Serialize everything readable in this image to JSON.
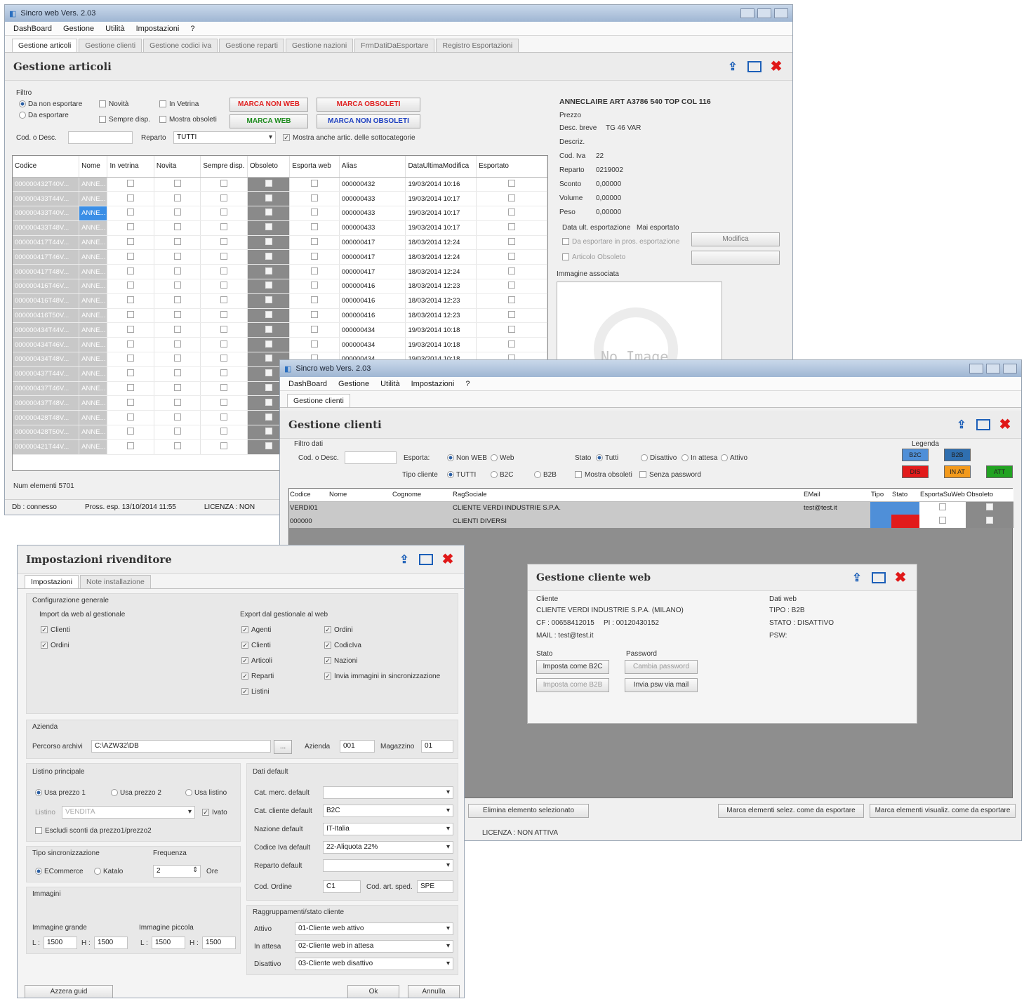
{
  "app": {
    "title": "Sincro web Vers. 2.03",
    "menu": [
      "DashBoard",
      "Gestione",
      "Utilità",
      "Impostazioni",
      "?"
    ]
  },
  "articoli": {
    "tabs": [
      "Gestione articoli",
      "Gestione clienti",
      "Gestione codici iva",
      "Gestione reparti",
      "Gestione nazioni",
      "FrmDatiDaEsportare",
      "Registro Esportazioni"
    ],
    "title": "Gestione articoli",
    "filter_label": "Filtro",
    "radio_non_esportare": "Da non esportare",
    "radio_esportare": "Da esportare",
    "chk_novita": "Novità",
    "chk_in_vetrina": "In Vetrina",
    "chk_sempre_disp": "Sempre disp.",
    "chk_mostra_obsoleti": "Mostra obsoleti",
    "btn_marca_non_web": "MARCA NON WEB",
    "btn_marca_obsoleti": "MARCA OBSOLETI",
    "btn_marca_web": "MARCA WEB",
    "btn_marca_non_obsoleti": "MARCA NON OBSOLETI",
    "cod_desc_label": "Cod. o Desc.",
    "reparto_label": "Reparto",
    "reparto_value": "TUTTI",
    "mostra_sottocat": "Mostra anche artic. delle sottocategorie",
    "columns": [
      "Codice",
      "Nome",
      "In vetrina",
      "Novita",
      "Sempre disp.",
      "Obsoleto",
      "Esporta web",
      "Alias",
      "DataUltimaModifica",
      "Esportato"
    ],
    "rows": [
      {
        "codice": "000000432T40V...",
        "nome": "ANNE...",
        "alias": "000000432",
        "data": "19/03/2014 10:16"
      },
      {
        "codice": "000000433T44V...",
        "nome": "ANNE...",
        "alias": "000000433",
        "data": "19/03/2014 10:17"
      },
      {
        "codice": "000000433T40V...",
        "nome": "ANNE...",
        "alias": "000000433",
        "data": "19/03/2014 10:17"
      },
      {
        "codice": "000000433T48V...",
        "nome": "ANNE...",
        "alias": "000000433",
        "data": "19/03/2014 10:17"
      },
      {
        "codice": "000000417T44V...",
        "nome": "ANNE...",
        "alias": "000000417",
        "data": "18/03/2014 12:24"
      },
      {
        "codice": "000000417T46V...",
        "nome": "ANNE...",
        "alias": "000000417",
        "data": "18/03/2014 12:24"
      },
      {
        "codice": "000000417T48V...",
        "nome": "ANNE...",
        "alias": "000000417",
        "data": "18/03/2014 12:24"
      },
      {
        "codice": "000000416T46V...",
        "nome": "ANNE...",
        "alias": "000000416",
        "data": "18/03/2014 12:23"
      },
      {
        "codice": "000000416T48V...",
        "nome": "ANNE...",
        "alias": "000000416",
        "data": "18/03/2014 12:23"
      },
      {
        "codice": "000000416T50V...",
        "nome": "ANNE...",
        "alias": "000000416",
        "data": "18/03/2014 12:23"
      },
      {
        "codice": "000000434T44V...",
        "nome": "ANNE...",
        "alias": "000000434",
        "data": "19/03/2014 10:18"
      },
      {
        "codice": "000000434T46V...",
        "nome": "ANNE...",
        "alias": "000000434",
        "data": "19/03/2014 10:18"
      },
      {
        "codice": "000000434T48V...",
        "nome": "ANNE...",
        "alias": "000000434",
        "data": "19/03/2014 10:18"
      },
      {
        "codice": "000000437T44V...",
        "nome": "ANNE...",
        "alias": "",
        "data": ""
      },
      {
        "codice": "000000437T46V...",
        "nome": "ANNE...",
        "alias": "",
        "data": ""
      },
      {
        "codice": "000000437T48V...",
        "nome": "ANNE...",
        "alias": "",
        "data": ""
      },
      {
        "codice": "000000428T48V...",
        "nome": "ANNE...",
        "alias": "",
        "data": ""
      },
      {
        "codice": "000000428T50V...",
        "nome": "ANNE...",
        "alias": "",
        "data": ""
      },
      {
        "codice": "000000421T44V...",
        "nome": "ANNE...",
        "alias": "",
        "data": ""
      }
    ],
    "num_elementi": "Num elementi 5701",
    "detail": {
      "title": "ANNECLAIRE ART A3786 540 TOP COL 116",
      "prezzo_label": "Prezzo",
      "desc_breve_label": "Desc. breve",
      "desc_breve_value": "TG 46 VAR",
      "descrizione_label": "Descriz.",
      "cod_iva_label": "Cod. Iva",
      "cod_iva_value": "22",
      "reparto_label": "Reparto",
      "reparto_value": "0219002",
      "sconto_label": "Sconto",
      "sconto_value": "0,00000",
      "volume_label": "Volume",
      "volume_value": "0,00000",
      "peso_label": "Peso",
      "peso_value": "0,00000",
      "data_export_label": "Data ult. esportazione",
      "data_export_value": "Mai esportato",
      "modifica_btn": "Modifica",
      "chk_da_esportare": "Da esportare in pros. esportazione",
      "chk_obsoleto": "Articolo Obsoleto",
      "immagine_label": "Immagine associata",
      "no_image": "No Image"
    },
    "status": {
      "db": "Db : connesso",
      "pross": "Pross. esp. 13/10/2014 11:55",
      "licenza": "LICENZA : NON"
    }
  },
  "clienti": {
    "tab": "Gestione clienti",
    "title": "Gestione clienti",
    "filtro_label": "Filtro dati",
    "cod_desc_label": "Cod. o Desc.",
    "esporta_label": "Esporta:",
    "esporta_options": [
      "Non WEB",
      "Web"
    ],
    "stato_label": "Stato",
    "stato_options": [
      "Tutti",
      "Disattivo",
      "In attesa",
      "Attivo"
    ],
    "tipo_label": "Tipo cliente",
    "tipo_options": [
      "TUTTI",
      "B2C",
      "B2B"
    ],
    "mostra_obsoleti": "Mostra obsoleti",
    "senza_password": "Senza password",
    "legenda_label": "Legenda",
    "legenda": [
      {
        "label": "B2C",
        "color": "#4f8fd8"
      },
      {
        "label": "B2B",
        "color": "#2f6fb0"
      },
      {
        "label": "DIS",
        "color": "#e21b1b"
      },
      {
        "label": "IN AT",
        "color": "#f39a1c"
      },
      {
        "label": "ATT",
        "color": "#22a322"
      }
    ],
    "columns": [
      "Codice",
      "Nome",
      "Cognome",
      "RagSociale",
      "EMail",
      "Tipo",
      "Stato",
      "EsportaSuWeb",
      "Obsoleto"
    ],
    "rows": [
      {
        "codice": "VERDI01",
        "ragsociale": "CLIENTE VERDI INDUSTRIE S.P.A.",
        "email": "test@test.it"
      },
      {
        "codice": "000000",
        "ragsociale": "CLIENTI DIVERSI",
        "email": ""
      }
    ],
    "btn_elimina": "Elimina elemento selezionato",
    "btn_marca_selez": "Marca elementi selez. come da esportare",
    "btn_marca_visual": "Marca elementi visualiz. come da esportare",
    "licenza": "LICENZA : NON ATTIVA"
  },
  "cliente_web": {
    "title": "Gestione cliente web",
    "cliente_label": "Cliente",
    "cliente_name": "CLIENTE VERDI INDUSTRIE S.P.A. (MILANO)",
    "cf": "CF : 00658412015",
    "pi": "PI : 00120430152",
    "mail": "MAIL : test@test.it",
    "dati_web_label": "Dati web",
    "tipo": "TIPO : B2B",
    "stato": "STATO : DISATTIVO",
    "pswd": "PSW:",
    "stato_section": "Stato",
    "password_section": "Password",
    "btn_imposta_b2c": "Imposta come B2C",
    "btn_imposta_b2b": "Imposta come B2B",
    "btn_cambia_password": "Cambia password",
    "btn_invia_password": "Invia psw via mail"
  },
  "rivenditore": {
    "title": "Impostazioni rivenditore",
    "tabs": [
      "Impostazioni",
      "Note installazione"
    ],
    "config_label": "Configurazione generale",
    "import_label": "Import da web al gestionale",
    "import_items": [
      "Clienti",
      "Ordini"
    ],
    "export_label": "Export dal gestionale al web",
    "export_col1": [
      "Agenti",
      "Clienti",
      "Articoli",
      "Reparti",
      "Listini"
    ],
    "export_col2": [
      "Ordini",
      "CodicIva",
      "Nazioni",
      "Invia immagini in sincronizzazione"
    ],
    "azienda_label": "Azienda",
    "percorso_label": "Percorso archivi",
    "percorso_value": "C:\\AZW32\\DB",
    "browse_btn": "...",
    "azienda_field_label": "Azienda",
    "azienda_value": "001",
    "magazzino_label": "Magazzino",
    "magazzino_value": "01",
    "listino_label": "Listino principale",
    "listino_options": [
      "Usa prezzo 1",
      "Usa prezzo 2",
      "Usa listino"
    ],
    "listino_field_label": "Listino",
    "listino_field_value": "VENDITA",
    "ivato_label": "Ivato",
    "escludi_label": "Escludi sconti da prezzo1/prezzo2",
    "sinc_label": "Tipo sincronizzazione",
    "sinc_options": [
      "ECommerce",
      "Katalo"
    ],
    "freq_label": "Frequenza",
    "freq_value": "2",
    "freq_unit": "Ore",
    "immagini_label": "Immagini",
    "img_grande_label": "Immagine grande",
    "img_piccola_label": "Immagine piccola",
    "img_grande_l": "1500",
    "img_grande_h": "1500",
    "img_piccola_l": "1500",
    "img_piccola_h": "1500",
    "l_label": "L :",
    "h_label": "H :",
    "dati_default_label": "Dati default",
    "defaults": [
      {
        "label": "Cat. merc. default",
        "value": ""
      },
      {
        "label": "Cat. cliente default",
        "value": "B2C"
      },
      {
        "label": "Nazione default",
        "value": "IT-Italia"
      },
      {
        "label": "Codice Iva default",
        "value": "22-Aliquota 22%"
      },
      {
        "label": "Reparto default",
        "value": ""
      }
    ],
    "cod_ordine_label": "Cod. Ordine",
    "cod_ordine_value": "C1",
    "cod_sped_label": "Cod. art. sped.",
    "cod_sped_value": "SPE",
    "raggr_label": "Raggruppamenti/stato cliente",
    "raggr": [
      {
        "label": "Attivo",
        "value": "01-Cliente web attivo"
      },
      {
        "label": "In attesa",
        "value": "02-Cliente web in attesa"
      },
      {
        "label": "Disattivo",
        "value": "03-Cliente web disattivo"
      }
    ],
    "btn_azzera": "Azzera guid",
    "btn_ok": "Ok",
    "btn_annulla": "Annulla"
  }
}
